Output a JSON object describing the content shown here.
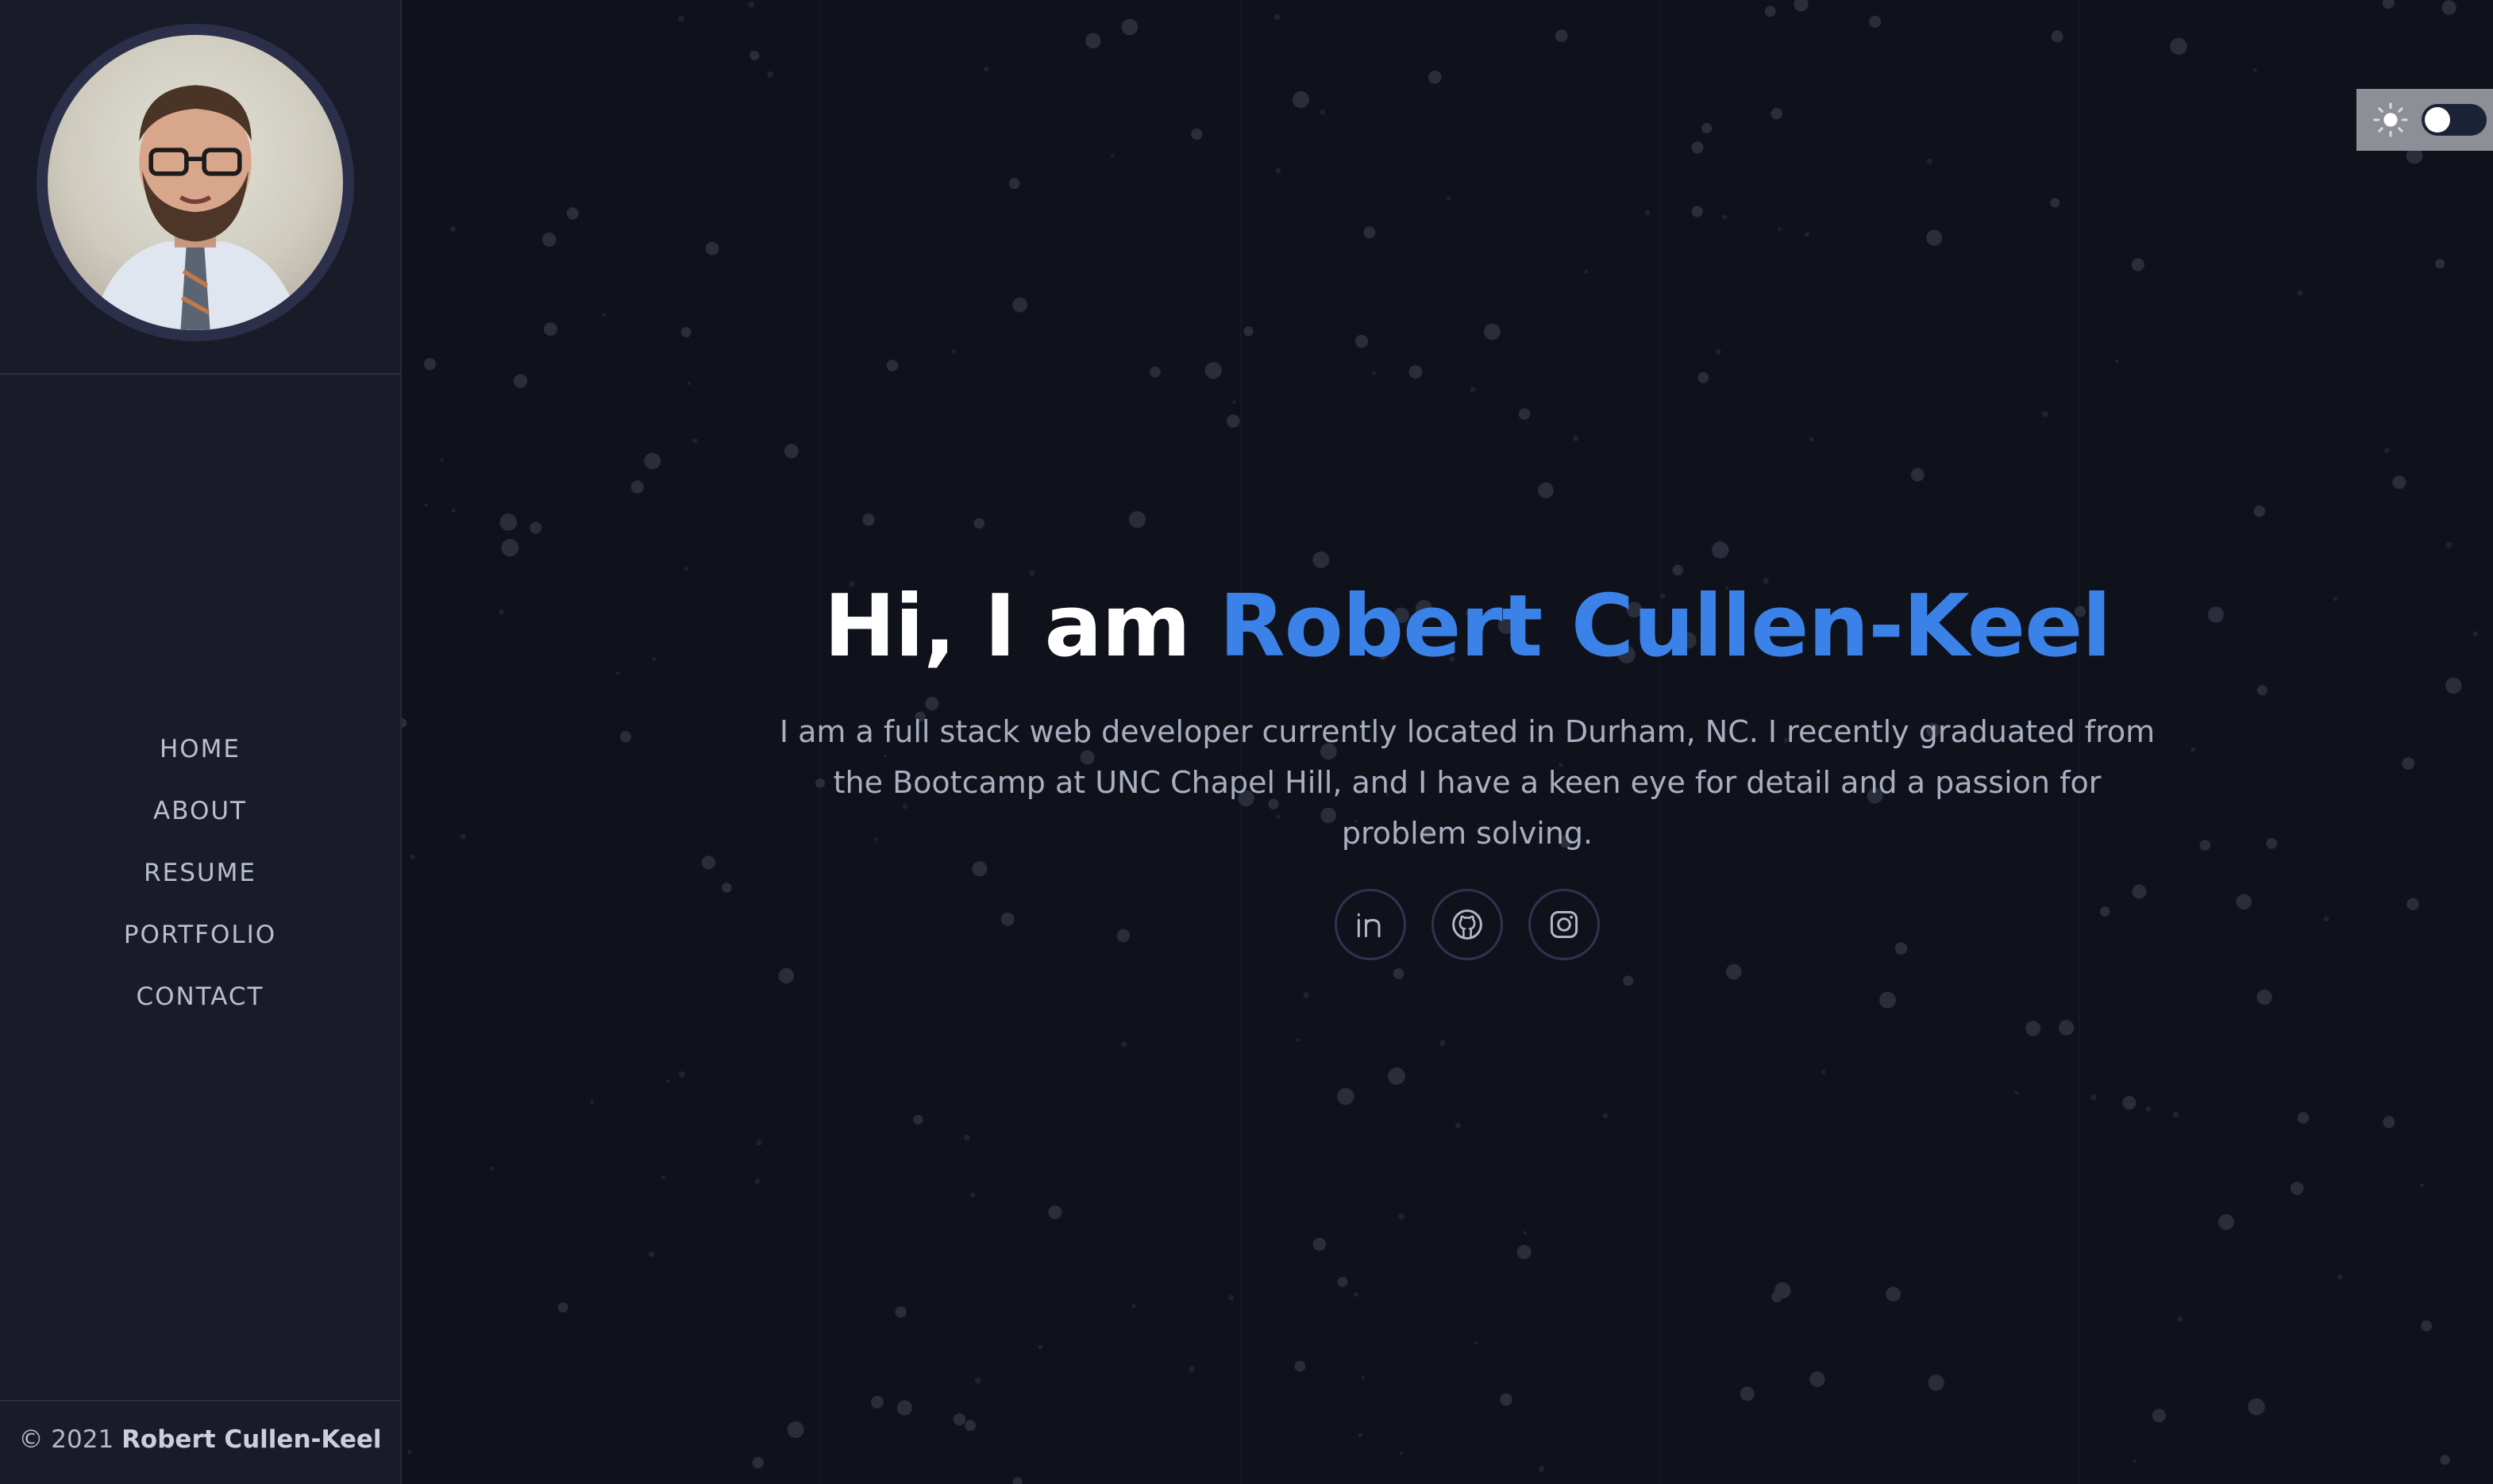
{
  "sidebar": {
    "nav": [
      {
        "label": "HOME"
      },
      {
        "label": "ABOUT"
      },
      {
        "label": "RESUME"
      },
      {
        "label": "PORTFOLIO"
      },
      {
        "label": "CONTACT"
      }
    ],
    "footer": {
      "copyright": "© 2021",
      "owner": "Robert Cullen-Keel"
    }
  },
  "hero": {
    "greeting": "Hi, I am",
    "name": "Robert Cullen-Keel",
    "description": "I am a full stack web developer currently located in Durham, NC. I recently graduated from the Bootcamp at UNC Chapel Hill, and I have a keen eye for detail and a passion for problem solving."
  },
  "socials": [
    {
      "icon": "linkedin-icon"
    },
    {
      "icon": "github-icon"
    },
    {
      "icon": "instagram-icon"
    }
  ],
  "theme_toggle": {
    "icon": "sun-icon",
    "state": "off"
  },
  "colors": {
    "accent": "#3b82e8",
    "sidebar_bg": "#191b28",
    "main_bg": "#10121b",
    "heading": "#ffffff",
    "muted_text": "#a9afc0"
  }
}
